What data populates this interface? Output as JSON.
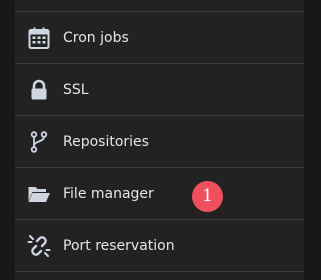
{
  "menu": {
    "items": [
      {
        "label": "Cron jobs",
        "icon": "calendar-icon"
      },
      {
        "label": "SSL",
        "icon": "lock-icon"
      },
      {
        "label": "Repositories",
        "icon": "git-branch-icon"
      },
      {
        "label": "File manager",
        "icon": "folder-open-icon"
      },
      {
        "label": "Port reservation",
        "icon": "broken-link-icon"
      }
    ]
  },
  "badge": {
    "value": "1"
  },
  "colors": {
    "background": "#222222",
    "outer_background": "#171717",
    "divider": "#3b3b3b",
    "text": "#e6e6e6",
    "icon": "#cfd6e2",
    "badge": "#f0505c"
  }
}
